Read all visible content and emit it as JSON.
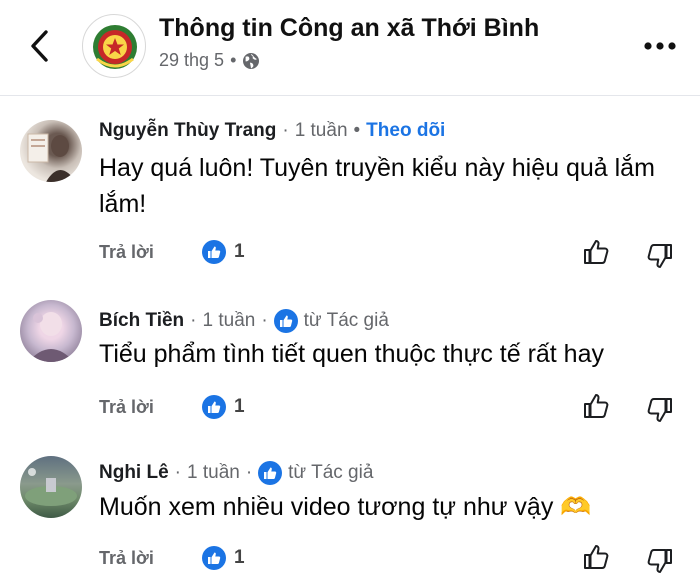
{
  "header": {
    "title": "Thông tin Công an xã Thới Bình",
    "date": "29 thg 5",
    "dot": "•"
  },
  "comments": [
    {
      "name": "Nguyễn Thùy Trang",
      "sep": "·",
      "time": "1 tuần",
      "sep2": "•",
      "follow": "Theo dõi",
      "text": "Hay quá luôn! Tuyên truyền kiểu này hiệu quả lắm lắm!",
      "reply": "Trả lời",
      "likes": "1"
    },
    {
      "name": "Bích Tiền",
      "sep": "·",
      "time": "1 tuần",
      "sep2": "·",
      "author": "từ Tác giả",
      "text": "Tiểu phẩm tình tiết quen thuộc thực tế rất hay",
      "reply": "Trả lời",
      "likes": "1"
    },
    {
      "name": "Nghi Lê",
      "sep": "·",
      "time": "1 tuần",
      "sep2": "·",
      "author": "từ Tác giả",
      "text": "Muốn xem nhiều video tương tự như vậy 🫶",
      "reply": "Trả lời",
      "likes": "1"
    }
  ],
  "icons": {
    "back": "chevron-left-icon",
    "more": "more-horizontal-icon",
    "globe": "globe-icon",
    "like": "thumbs-up-icon",
    "dislike": "thumbs-down-icon"
  },
  "colors": {
    "accent": "#1b74e4",
    "muted": "#65676b"
  }
}
